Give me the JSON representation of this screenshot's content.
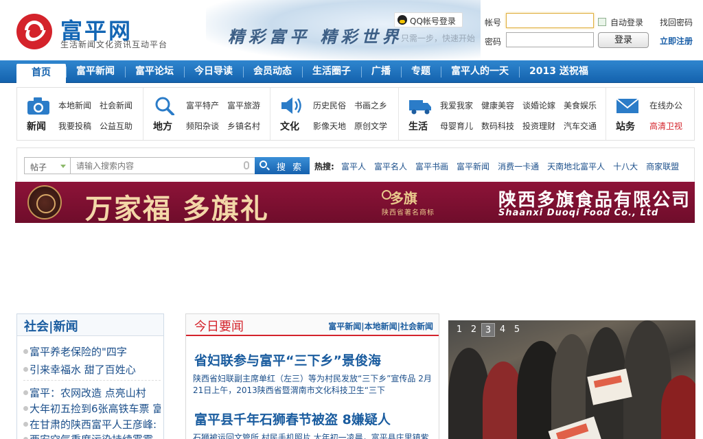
{
  "site": {
    "name": "富平网",
    "slogan": "生活新闻文化资讯互动平台",
    "banner_text": "精彩富平  精彩世界"
  },
  "login": {
    "qq_label": "QQ帐号登录",
    "qq_tip": "只需一步，快速开始",
    "account_label": "帐号",
    "password_label": "密码",
    "auto_login_label": "自动登录",
    "find_password": "找回密码",
    "login_button": "登录",
    "register": "立即注册"
  },
  "nav": {
    "items": [
      "首页",
      "富平新闻",
      "富平论坛",
      "今日导读",
      "会员动态",
      "生活圈子",
      "广播",
      "专题",
      "富平人的一天",
      "2013 送祝福"
    ]
  },
  "channels": [
    {
      "title": "新闻",
      "icon": "camera-icon",
      "links": [
        "本地新闻",
        "社会新闻",
        "我要投稿",
        "公益互助"
      ]
    },
    {
      "title": "地方",
      "icon": "magnifier-icon",
      "links": [
        "富平特产",
        "富平旅游",
        "频阳杂谈",
        "乡镇名村"
      ]
    },
    {
      "title": "文化",
      "icon": "speaker-icon",
      "links": [
        "历史民俗",
        "书画之乡",
        "影像天地",
        "原创文学"
      ]
    },
    {
      "title": "生活",
      "icon": "truck-icon",
      "links": [
        "我爱我家",
        "健康美容",
        "谈婚论嫁",
        "美食娱乐",
        "母婴育儿",
        "数码科技",
        "投资理财",
        "汽车交通"
      ]
    },
    {
      "title": "站务",
      "icon": "mail-icon",
      "links": [
        "在线办公",
        "高清卫视"
      ]
    }
  ],
  "search": {
    "category": "帖子",
    "placeholder": "请输入搜索内容",
    "button": "搜 索",
    "hot_label": "热搜:",
    "hot": [
      "富平人",
      "富平名人",
      "富平书画",
      "富平新闻",
      "消费一卡通",
      "天南地北富平人",
      "十八大",
      "商家联盟"
    ]
  },
  "ad": {
    "slogan": "万家福 多旗礼",
    "brand_name": "多旗",
    "brand_sub": "陕西省著名商标",
    "company": "陕西多旗食品有限公司",
    "company_en": "Shaanxi Duoqi Food Co., Ltd"
  },
  "social": {
    "title": "社会|新闻",
    "items": [
      "富平养老保险的\"四字",
      "引来幸福水 甜了百姓心",
      "富平：农网改造 点亮山村",
      "大年初五捡到6张高铁车票 富",
      "在甘肃的陕西富平人王彦峰:",
      "西安空气重度污染持续雾霾"
    ]
  },
  "today": {
    "title": "今日要闻",
    "links": "富平新闻|本地新闻|社会新闻",
    "headline1": "省妇联参与富平“三下乡”景俊海",
    "summary1": "陕西省妇联副主席单红（左三）等为村民发放“三下乡”宣传品 2月21日上午，2013陕西省暨渭南市文化科技卫生“三下",
    "headline2": "富平县千年石狮春节被盗 8嫌疑人",
    "summary2": "石狮被运回文管所 村民手机照片 大年初一凌晨，富平县庄里镇紫"
  },
  "slider": {
    "pages": [
      "1",
      "2",
      "3",
      "4",
      "5"
    ],
    "active_index": 3
  }
}
